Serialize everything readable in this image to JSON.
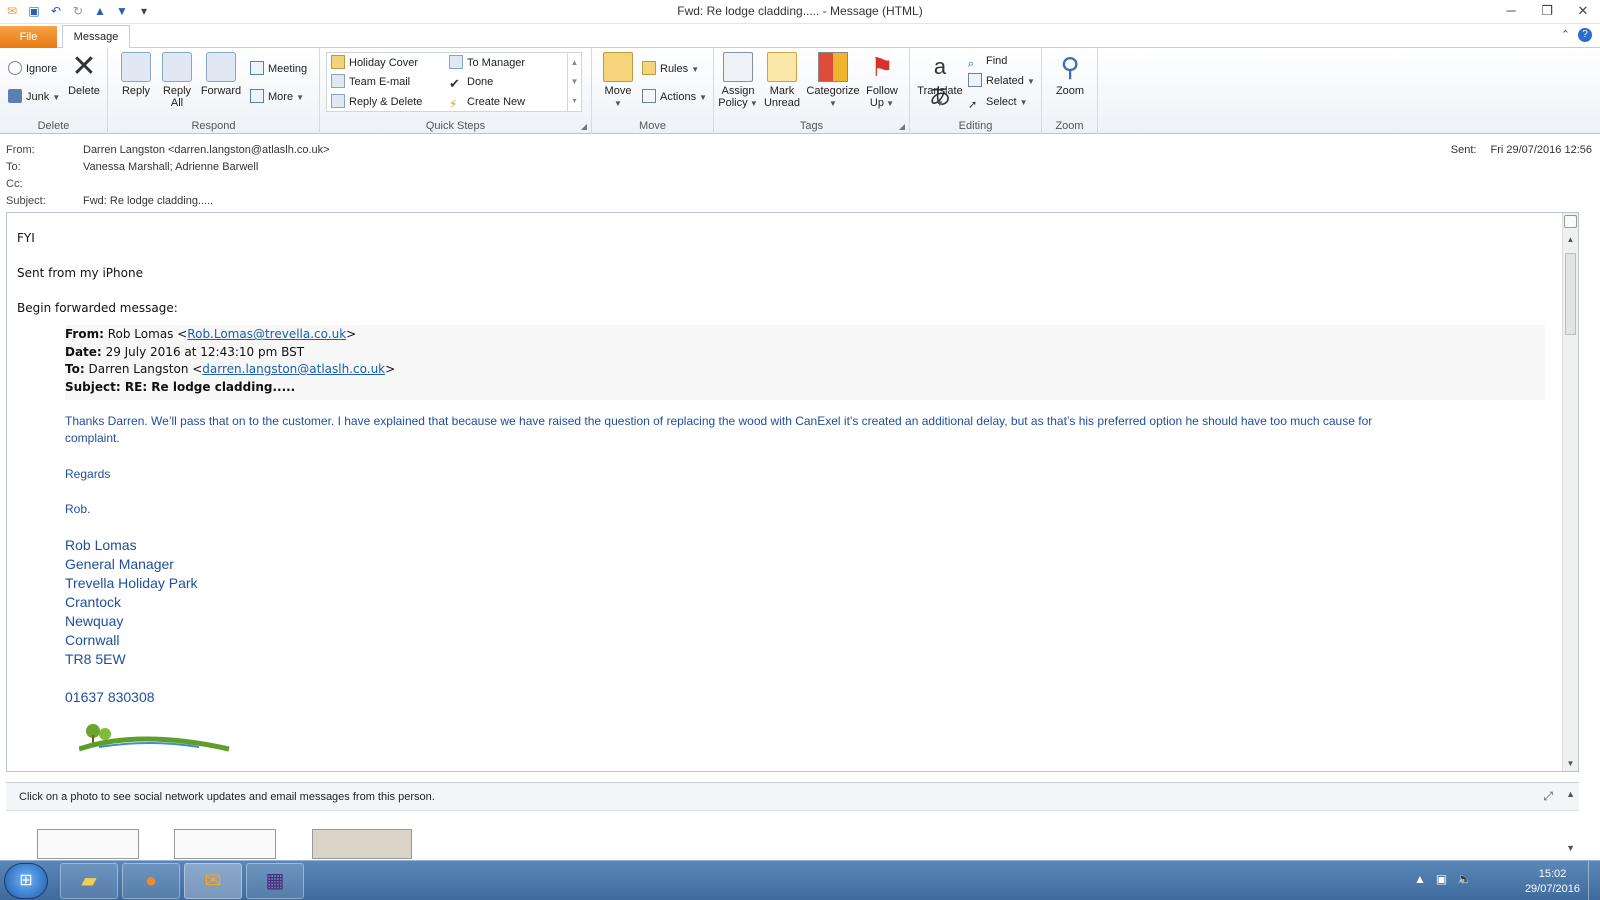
{
  "window": {
    "title": "Fwd: Re lodge cladding.....  -  Message (HTML)"
  },
  "tabs": {
    "file": "File",
    "message": "Message"
  },
  "ribbon": {
    "delete": {
      "label": "Delete",
      "ignore": "Ignore",
      "junk": "Junk",
      "delete_btn": "Delete"
    },
    "respond": {
      "label": "Respond",
      "reply": "Reply",
      "reply_all_1": "Reply",
      "reply_all_2": "All",
      "forward": "Forward",
      "meeting": "Meeting",
      "more": "More"
    },
    "quick_steps": {
      "label": "Quick Steps",
      "items": [
        "Holiday Cover",
        "Team E-mail",
        "Reply & Delete",
        "To Manager",
        "Done",
        "Create New"
      ]
    },
    "move": {
      "label": "Move",
      "move_btn": "Move",
      "rules": "Rules",
      "actions": "Actions"
    },
    "tags": {
      "label": "Tags",
      "assign_1": "Assign",
      "assign_2": "Policy",
      "mark_1": "Mark",
      "mark_2": "Unread",
      "categorize": "Categorize",
      "follow_1": "Follow",
      "follow_2": "Up"
    },
    "editing": {
      "label": "Editing",
      "translate": "Translate",
      "find": "Find",
      "related": "Related",
      "select": "Select"
    },
    "zoom": {
      "label": "Zoom",
      "zoom_btn": "Zoom"
    }
  },
  "header": {
    "from_label": "From:",
    "from": "Darren Langston <darren.langston@atlaslh.co.uk>",
    "to_label": "To:",
    "to": "Vanessa Marshall; Adrienne Barwell",
    "cc_label": "Cc:",
    "cc": "",
    "subject_label": "Subject:",
    "subject": "Fwd: Re lodge cladding.....",
    "sent_label": "Sent:",
    "sent": "Fri 29/07/2016 12:56"
  },
  "body": {
    "fyi": "FYI",
    "sent_from": "Sent from my iPhone",
    "begin": "Begin forwarded message:",
    "fwd": {
      "from_label": "From:",
      "from_name": "Rob Lomas <",
      "from_email": "Rob.Lomas@trevella.co.uk",
      "from_close": ">",
      "date_label": "Date:",
      "date": "29 July 2016 at 12:43:10 pm BST",
      "to_label": "To:",
      "to_name": "Darren Langston <",
      "to_email": "darren.langston@atlaslh.co.uk",
      "to_close": ">",
      "subject_label": "Subject:",
      "subject": "RE: Re lodge cladding.....",
      "para1": "Thanks Darren. We’ll pass that on to the customer. I have explained that because we have raised the question of replacing the wood with CanExel it’s created an additional delay, but as that’s his preferred option he should have too much cause for",
      "para1b": "complaint.",
      "regards": "Regards",
      "rob": "Rob.",
      "signature": [
        "Rob Lomas",
        "General Manager",
        "Trevella Holiday Park",
        "Crantock",
        "Newquay",
        "Cornwall",
        "TR8 5EW"
      ],
      "phone": "01637 830308"
    }
  },
  "people_pane": {
    "text": "Click on a photo to see social network updates and email messages from this person."
  },
  "taskbar": {
    "time": "15:02",
    "date": "29/07/2016"
  }
}
